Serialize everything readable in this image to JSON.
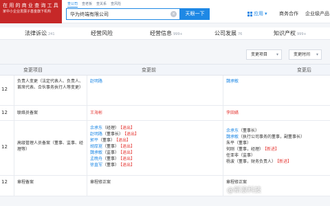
{
  "header": {
    "logo_line1": "在 用 的 商 业 查 询 工 具",
    "logo_line2": "家中小企业发展子基金旗下机构",
    "search_tabs": [
      "查公司",
      "查老板",
      "查关系",
      "查风险"
    ],
    "search_value": "华为终端有限公司",
    "search_button": "天眼一下",
    "nav_apps": "应用",
    "nav_business": "商务合作",
    "nav_enterprise": "企业级产品"
  },
  "category_tabs": [
    {
      "label": "法律诉讼",
      "count": "241"
    },
    {
      "label": "经营风险",
      "count": ""
    },
    {
      "label": "经营信息",
      "count": "999+"
    },
    {
      "label": "公司发展",
      "count": "76"
    },
    {
      "label": "知识产权",
      "count": "999+"
    }
  ],
  "filters": {
    "change_item": "变更项目",
    "change_time": "变更时间"
  },
  "table": {
    "headers": {
      "item": "变更项目",
      "before": "变更前",
      "after": "变更后"
    },
    "rows": [
      {
        "date": "12",
        "item": "负责人变更（法定代表人、负责人、首席代表、合伙事务执行人等变更）",
        "before": [
          {
            "name": "赵明路",
            "role": "",
            "tag": ""
          }
        ],
        "after": [
          {
            "name": "魏承敏",
            "role": "",
            "tag": ""
          }
        ]
      },
      {
        "date": "12",
        "item": "联络员备案",
        "before": [
          {
            "name": "王海彬",
            "role": "",
            "tag": ""
          }
        ],
        "after": [
          {
            "name": "李田嬿",
            "role": "",
            "tag": ""
          }
        ]
      },
      {
        "date": "12",
        "item": "高级管理人员备案（董事、监事、经理等）",
        "before": [
          {
            "name": "余承东",
            "role": "（经理）",
            "tag": "【退出】"
          },
          {
            "name": "赵明路",
            "role": "（董事长）",
            "tag": "【退出】"
          },
          {
            "name": "郭平",
            "role": "（董事）",
            "tag": "【退出】"
          },
          {
            "name": "胡厚崑",
            "role": "（董事）",
            "tag": "【退出】"
          },
          {
            "name": "魏承敏",
            "role": "（监事）",
            "tag": "【退出】"
          },
          {
            "name": "孟晚舟",
            "role": "（董事）",
            "tag": "【退出】"
          },
          {
            "name": "徐直军",
            "role": "（董事）",
            "tag": "【退出】"
          }
        ],
        "after": [
          {
            "name": "余承东",
            "role": "（董事长）",
            "tag": ""
          },
          {
            "name": "魏承敏",
            "role": "（执行公司事务的董事，副董事长）",
            "tag": ""
          },
          {
            "name": "朱平",
            "role": "（董事）",
            "tag": ""
          },
          {
            "name": "何刚",
            "role": "（董事，经理）",
            "tag": "【新进】"
          },
          {
            "name": "任亚非",
            "role": "（监事）",
            "tag": ""
          },
          {
            "name": "杨波",
            "role": "（董事，财务负责人）",
            "tag": "【新进】"
          }
        ]
      },
      {
        "date": "12",
        "item": "章程备案",
        "before": [
          {
            "name": "章程修正案",
            "role": "",
            "tag": ""
          }
        ],
        "after": [
          {
            "name": "章程修正案",
            "role": "",
            "tag": ""
          }
        ]
      }
    ]
  },
  "watermark": "@新浪科技"
}
